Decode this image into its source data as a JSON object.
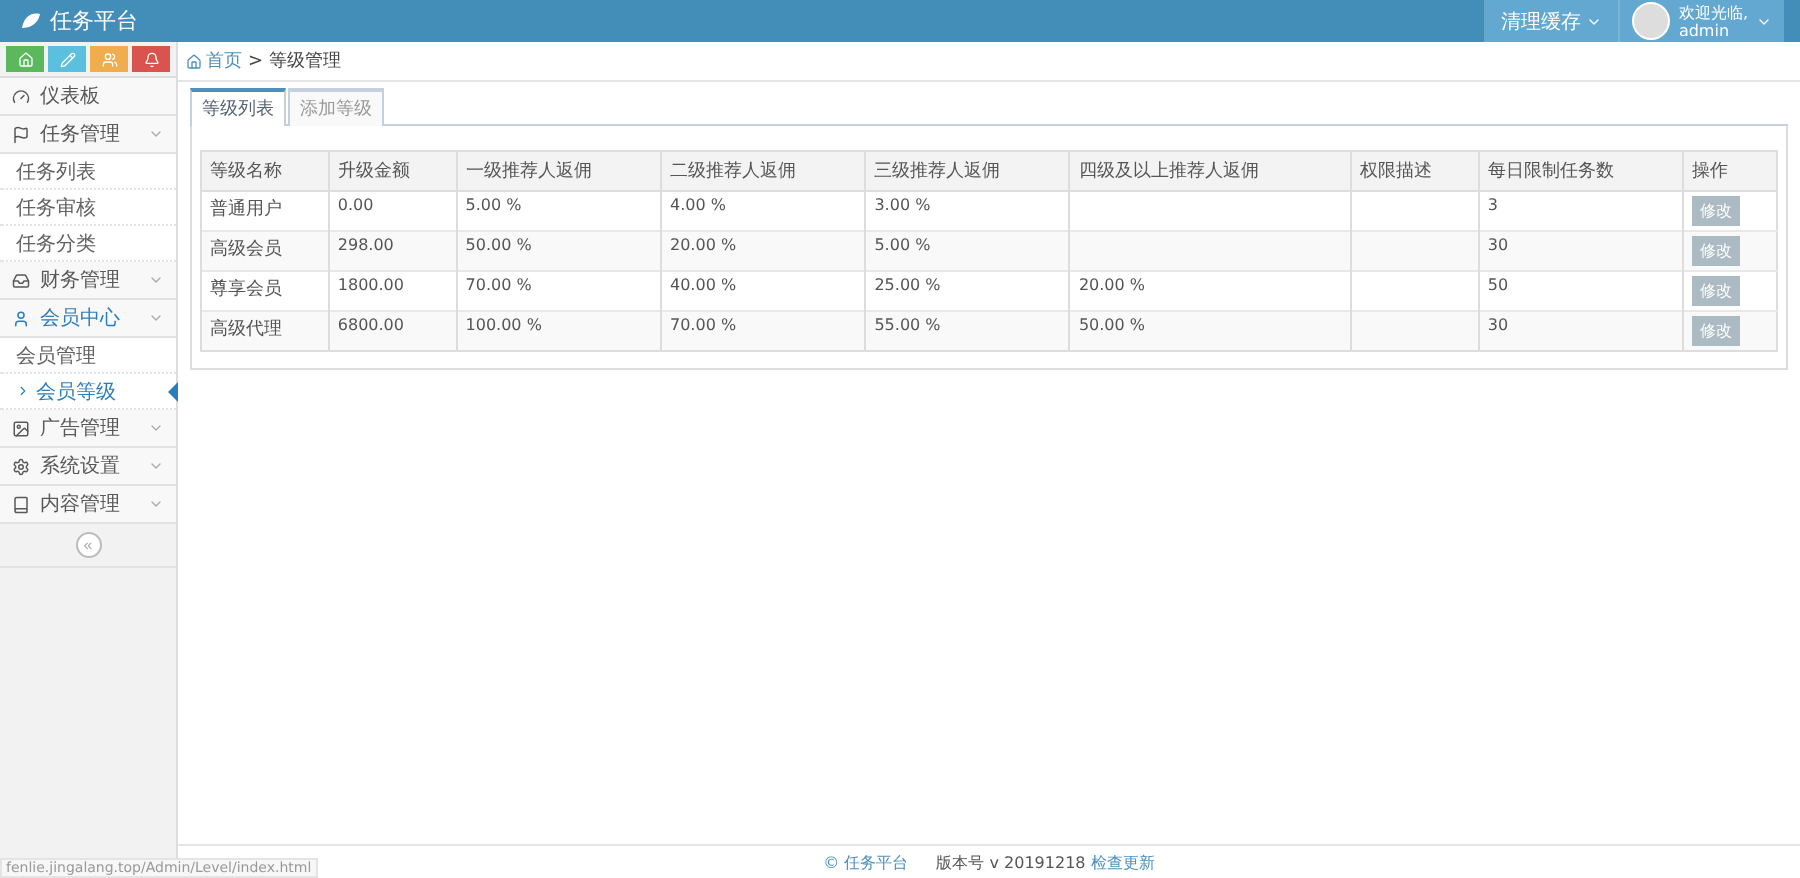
{
  "header": {
    "brand": "任务平台",
    "clear_cache": "清理缓存",
    "welcome": "欢迎光临,",
    "user": "admin"
  },
  "quick_buttons": [
    {
      "color": "#5cb85c"
    },
    {
      "color": "#5bc0de"
    },
    {
      "color": "#f0ad4e"
    },
    {
      "color": "#d9534f"
    }
  ],
  "sidebar": {
    "items": [
      {
        "label": "仪表板",
        "selected": false
      },
      {
        "label": "任务管理",
        "selected": false,
        "children": [
          {
            "label": "任务列表",
            "selected": false
          },
          {
            "label": "任务审核",
            "selected": false
          },
          {
            "label": "任务分类",
            "selected": false
          }
        ]
      },
      {
        "label": "财务管理",
        "selected": false
      },
      {
        "label": "会员中心",
        "selected": true,
        "children": [
          {
            "label": "会员管理",
            "selected": false
          },
          {
            "label": "会员等级",
            "selected": true
          }
        ]
      },
      {
        "label": "广告管理",
        "selected": false
      },
      {
        "label": "系统设置",
        "selected": false
      },
      {
        "label": "内容管理",
        "selected": false
      }
    ],
    "collapse": "«"
  },
  "breadcrumb": {
    "home": "首页",
    "separator": ">",
    "current": "等级管理"
  },
  "tabs": [
    {
      "label": "等级列表",
      "selected": true
    },
    {
      "label": "添加等级",
      "selected": false
    }
  ],
  "table": {
    "columns": [
      "等级名称",
      "升级金额",
      "一级推荐人返佣",
      "二级推荐人返佣",
      "三级推荐人返佣",
      "四级及以上推荐人返佣",
      "权限描述",
      "每日限制任务数",
      "操作"
    ],
    "rows": [
      {
        "cells": [
          "普通用户",
          "0.00",
          "5.00 %",
          "4.00 %",
          "3.00 %",
          "",
          "",
          "3"
        ],
        "action": "修改"
      },
      {
        "cells": [
          "高级会员",
          "298.00",
          "50.00 %",
          "20.00 %",
          "5.00 %",
          "",
          "",
          "30"
        ],
        "action": "修改"
      },
      {
        "cells": [
          "尊享会员",
          "1800.00",
          "70.00 %",
          "40.00 %",
          "25.00 %",
          "20.00 %",
          "",
          "50"
        ],
        "action": "修改"
      },
      {
        "cells": [
          "高级代理",
          "6800.00",
          "100.00 %",
          "70.00 %",
          "55.00 %",
          "50.00 %",
          "",
          "30"
        ],
        "action": "修改"
      }
    ]
  },
  "footer": {
    "copyright": "© 任务平台",
    "version": "版本号 v 20191218",
    "update_link": "检查更新"
  },
  "status_url": "fenlie.jingalang.top/Admin/Level/index.html"
}
